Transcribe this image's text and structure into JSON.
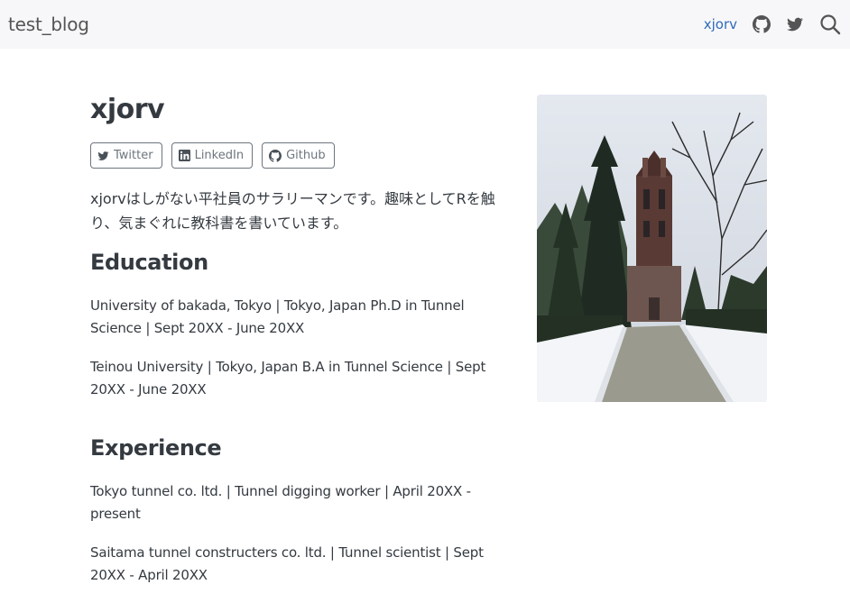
{
  "navbar": {
    "brand": "test_blog",
    "links": [
      {
        "label": "xjorv"
      }
    ],
    "icons": [
      "github-icon",
      "twitter-icon",
      "search-icon"
    ]
  },
  "about": {
    "title": "xjorv",
    "links": [
      {
        "label": "Twitter",
        "icon": "twitter-icon"
      },
      {
        "label": "LinkedIn",
        "icon": "linkedin-icon"
      },
      {
        "label": "Github",
        "icon": "github-icon"
      }
    ],
    "bio": "xjorvはしがない平社員のサラリーマンです。趣味としてRを触り、気まぐれに教科書を書いています。"
  },
  "education": {
    "heading": "Education",
    "entries": [
      "University of bakada, Tokyo | Tokyo, Japan Ph.D in Tunnel Science | Sept 20XX - June 20XX",
      "Teinou University | Tokyo, Japan B.A in Tunnel Science | Sept 20XX - June 20XX"
    ]
  },
  "experience": {
    "heading": "Experience",
    "entries": [
      "Tokyo tunnel co. ltd. | Tunnel digging worker | April 20XX - present",
      "Saitama tunnel constructers co. ltd. | Tunnel scientist | Sept 20XX - April 20XX"
    ]
  },
  "colors": {
    "accent": "#2e6bb8",
    "navbar_bg": "#f7f7f9",
    "text": "#343a40",
    "muted": "#6c757d"
  }
}
